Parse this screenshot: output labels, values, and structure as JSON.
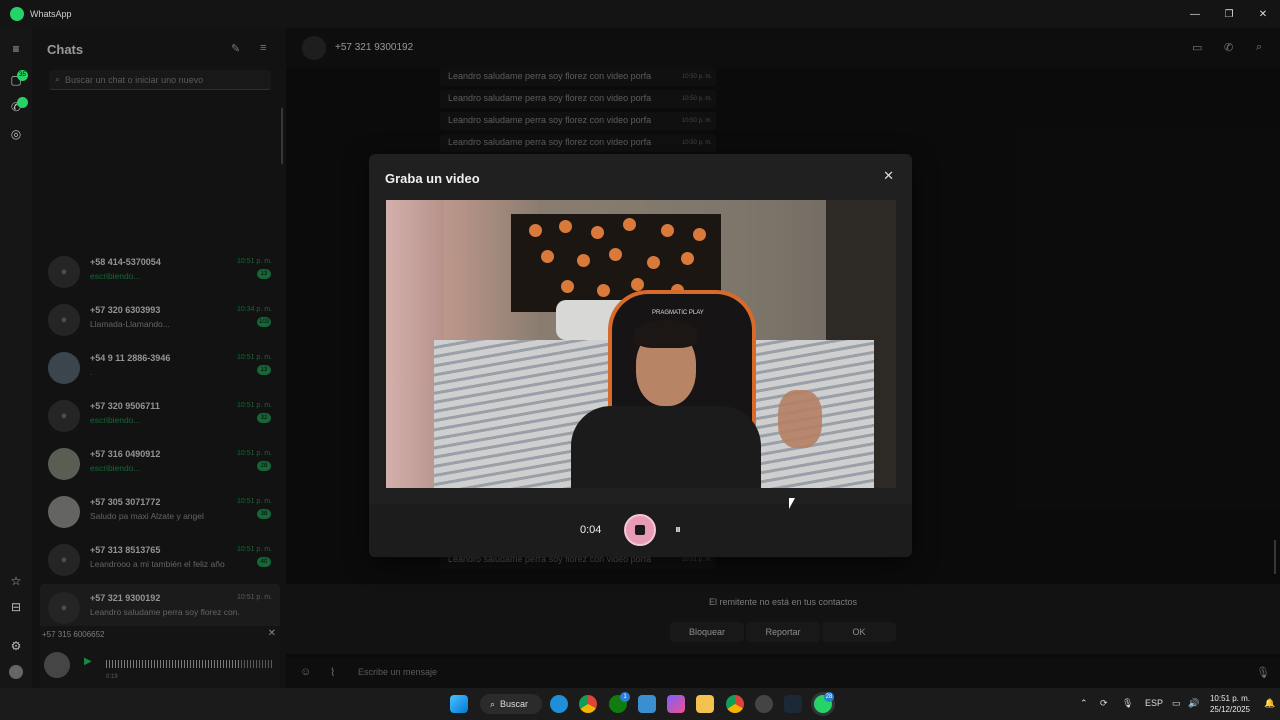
{
  "window": {
    "title": "WhatsApp"
  },
  "rail": {
    "chats_badge": "35",
    "calls_badge": ""
  },
  "chatlist": {
    "title": "Chats",
    "search_placeholder": "Buscar un chat o iniciar uno nuevo",
    "chats": [
      {
        "name": "+58 414-5370054",
        "preview": "escribiendo...",
        "time": "10:51 p. m.",
        "unread": "13",
        "typing": true
      },
      {
        "name": "+57 320 6303993",
        "preview": "Llamada-Llamando...",
        "time": "10:34 p. m.",
        "unread": "103",
        "typing": false
      },
      {
        "name": "+54 9 11 2886-3946",
        "preview": ".",
        "time": "10:51 p. m.",
        "unread": "13",
        "typing": true
      },
      {
        "name": "+57 320 9506711",
        "preview": "escribiendo...",
        "time": "10:51 p. m.",
        "unread": "32",
        "typing": true
      },
      {
        "name": "+57 316 0490912",
        "preview": "escribiendo...",
        "time": "10:51 p. m.",
        "unread": "28",
        "typing": true
      },
      {
        "name": "+57 305 3071772",
        "preview": "Saludo pa maxi Alzate y angel",
        "time": "10:51 p. m.",
        "unread": "38",
        "typing": false
      },
      {
        "name": "+57 313 8513765",
        "preview": "Leandrooo a mi también el feliz año",
        "time": "10:51 p. m.",
        "unread": "40",
        "typing": false
      },
      {
        "name": "+57 321 9300192",
        "preview": "Leandro saludame perra soy florez con...",
        "time": "10:51 p. m.",
        "unread": "",
        "typing": false
      }
    ]
  },
  "audio": {
    "name": "+57 315 6006652",
    "time": "0:19",
    "progress": 0.8
  },
  "conversation": {
    "contact": "+57 321 9300192",
    "messages": [
      {
        "text": "Leandro saludame perra soy florez con video porfa",
        "time": "10:50 p. m."
      },
      {
        "text": "Leandro saludame perra soy florez con video porfa",
        "time": "10:50 p. m."
      },
      {
        "text": "Leandro saludame perra soy florez con video porfa",
        "time": "10:50 p. m."
      },
      {
        "text": "Leandro saludame perra soy florez con video porfa",
        "time": "10:50 p. m."
      },
      {
        "text": "Leandro saludame perra soy florez con video porfa",
        "time": "10:51 p. m."
      }
    ],
    "notice": "El remitente no está en tus contactos",
    "buttons": {
      "block": "Bloquear",
      "report": "Reportar",
      "ok": "OK"
    },
    "composer_placeholder": "Escribe un mensaje"
  },
  "modal": {
    "title": "Graba un video",
    "elapsed": "0:04",
    "chair_brand": "PRAGMATIC PLAY"
  },
  "taskbar": {
    "search_label": "Buscar",
    "language": "ESP",
    "time": "10:51 p. m.",
    "date": "25/12/2025",
    "whatsapp_badge": "28",
    "xbox_badge": "1"
  },
  "colors": {
    "accent": "#25d366",
    "record": "#e89bb4"
  }
}
